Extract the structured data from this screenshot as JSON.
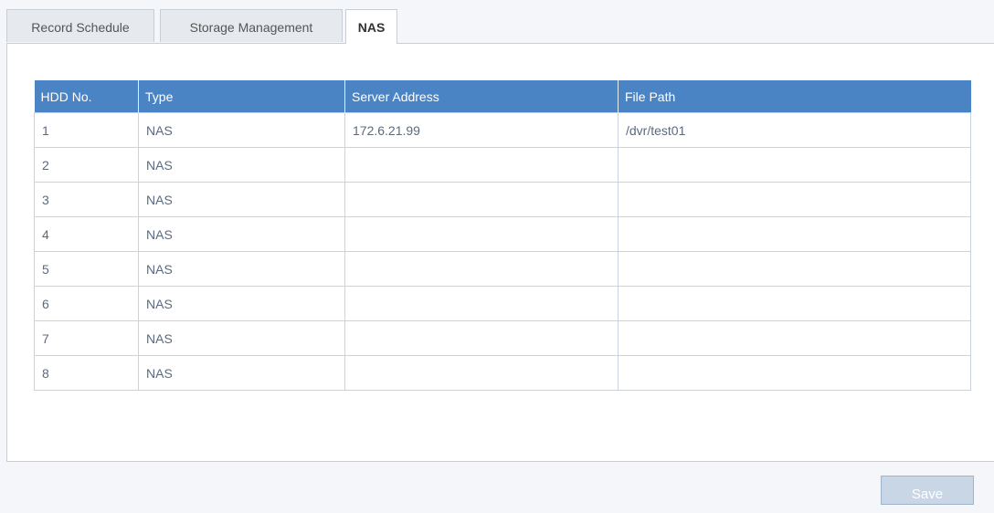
{
  "tabs": [
    {
      "label": "Record Schedule",
      "active": false
    },
    {
      "label": "Storage Management",
      "active": false
    },
    {
      "label": "NAS",
      "active": true
    }
  ],
  "table": {
    "headers": [
      "HDD No.",
      "Type",
      "Server Address",
      "File Path"
    ],
    "rows": [
      [
        "1",
        "NAS",
        "172.6.21.99",
        "/dvr/test01"
      ],
      [
        "2",
        "NAS",
        "",
        ""
      ],
      [
        "3",
        "NAS",
        "",
        ""
      ],
      [
        "4",
        "NAS",
        "",
        ""
      ],
      [
        "5",
        "NAS",
        "",
        ""
      ],
      [
        "6",
        "NAS",
        "",
        ""
      ],
      [
        "7",
        "NAS",
        "",
        ""
      ],
      [
        "8",
        "NAS",
        "",
        ""
      ]
    ]
  },
  "save_label": "Save"
}
